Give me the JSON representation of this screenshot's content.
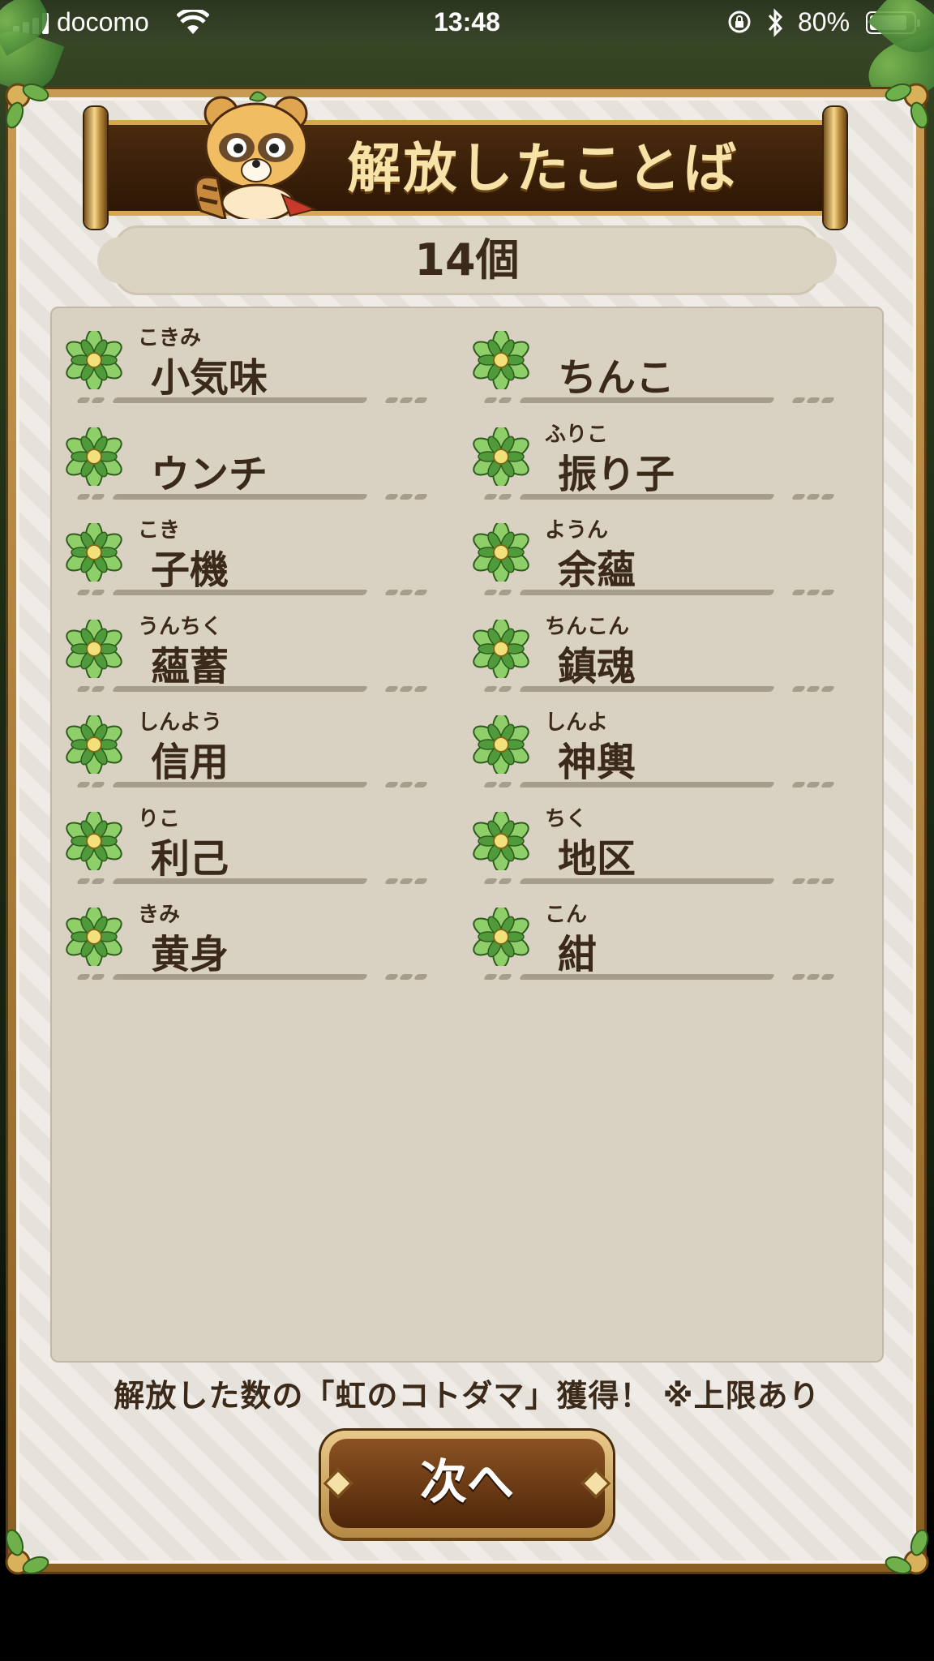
{
  "status_bar": {
    "carrier": "docomo",
    "time": "13:48",
    "battery_percent_text": "80%",
    "battery_level": 0.8
  },
  "screen": {
    "title": "解放したことば",
    "count": "14個",
    "reward_note": "解放した数の「虹のコトダマ」獲得！ ※上限あり",
    "next_button": "次へ"
  },
  "words": [
    {
      "ruby": "こきみ",
      "word": "小気味"
    },
    {
      "ruby": "",
      "word": "ちんこ"
    },
    {
      "ruby": "",
      "word": "ウンチ"
    },
    {
      "ruby": "ふりこ",
      "word": "振り子"
    },
    {
      "ruby": "こき",
      "word": "子機"
    },
    {
      "ruby": "ようん",
      "word": "余蘊"
    },
    {
      "ruby": "うんちく",
      "word": "蘊蓄"
    },
    {
      "ruby": "ちんこん",
      "word": "鎮魂"
    },
    {
      "ruby": "しんよう",
      "word": "信用"
    },
    {
      "ruby": "しんよ",
      "word": "神輿"
    },
    {
      "ruby": "りこ",
      "word": "利己"
    },
    {
      "ruby": "ちく",
      "word": "地区"
    },
    {
      "ruby": "きみ",
      "word": "黄身"
    },
    {
      "ruby": "こん",
      "word": "紺"
    }
  ],
  "icons": {
    "word_icon": "leaf-flower-icon",
    "mascot": "tanuki-mascot"
  },
  "colors": {
    "text_dark": "#3b2a1a",
    "banner": "#2d1705",
    "gold": "#d5a850",
    "button": "#6a3a14"
  }
}
